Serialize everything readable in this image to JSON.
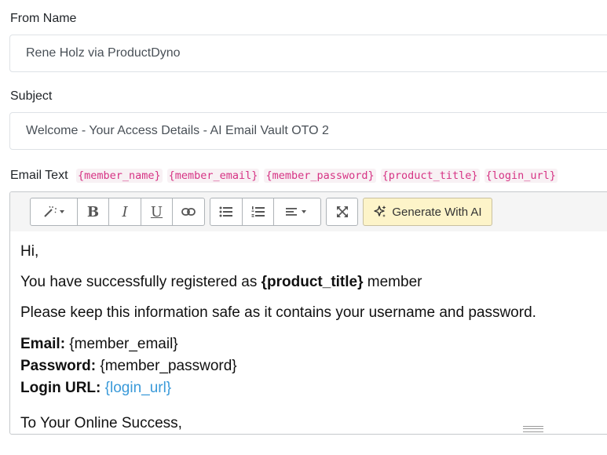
{
  "from_name": {
    "label": "From Name",
    "value": "Rene Holz via ProductDyno"
  },
  "subject": {
    "label": "Subject",
    "value": "Welcome - Your Access Details - AI Email Vault OTO 2"
  },
  "email_text": {
    "label": "Email Text",
    "variables": [
      "{member_name}",
      "{member_email}",
      "{member_password}",
      "{product_title}",
      "{login_url}"
    ]
  },
  "toolbar": {
    "magic_icon": "magic-wand-icon",
    "bold": "B",
    "italic": "I",
    "underline": "U",
    "link_icon": "link-icon",
    "ul_icon": "unordered-list-icon",
    "ol_icon": "ordered-list-icon",
    "align_icon": "align-left-icon",
    "fullscreen_icon": "fullscreen-icon",
    "ai_button_label": "Generate With AI"
  },
  "body": {
    "greeting": "Hi,",
    "line1_prefix": "You have successfully registered as ",
    "line1_bold": "{product_title}",
    "line1_suffix": " member",
    "line2": "Please keep this information safe as it contains your username and password.",
    "email_label": "Email:",
    "email_value": " {member_email}",
    "password_label": "Password:",
    "password_value": " {member_password}",
    "login_label": "Login URL:",
    "login_value": "{login_url}",
    "cut_off": "To Your Online Success,"
  }
}
